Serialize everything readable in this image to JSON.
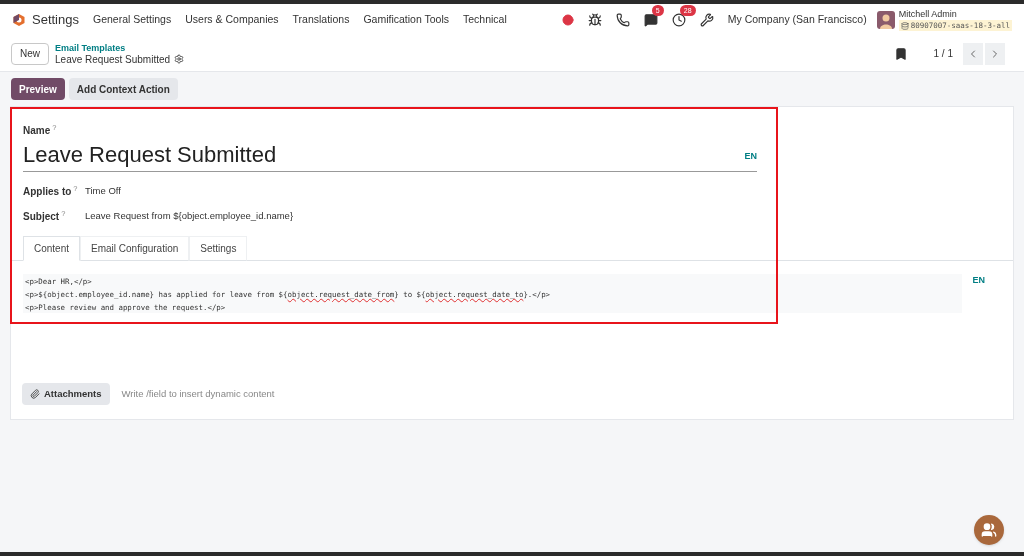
{
  "navbar": {
    "app": "Settings",
    "menu": [
      "General Settings",
      "Users & Companies",
      "Translations",
      "Gamification Tools",
      "Technical"
    ],
    "systray": [
      {
        "kind": "record"
      },
      {
        "kind": "bug"
      },
      {
        "kind": "phone"
      },
      {
        "kind": "chat",
        "badge": "5"
      },
      {
        "kind": "clock",
        "badge": "28"
      },
      {
        "kind": "tools"
      }
    ],
    "company": "My Company (San Francisco)",
    "user": "Mitchell Admin",
    "database": "80907007-saas-18-3-all"
  },
  "breadcrumb": {
    "new_button": "New",
    "parent": "Email Templates",
    "current": "Leave Request Submitted"
  },
  "pager": {
    "value": "1 / 1"
  },
  "actions": [
    {
      "label": "Preview",
      "primary": true
    },
    {
      "label": "Add Context Action",
      "primary": false
    }
  ],
  "form": {
    "name_label": "Name",
    "help_mark": "?",
    "name_value": "Leave Request Submitted",
    "name_lang": "EN",
    "fields": [
      {
        "label": "Applies to",
        "value": "Time Off"
      },
      {
        "label": "Subject",
        "value": "Leave Request from ${object.employee_id.name}"
      }
    ],
    "tabs": [
      {
        "label": "Content",
        "selected": true
      },
      {
        "label": "Email Configuration",
        "selected": false
      },
      {
        "label": "Settings",
        "selected": false
      }
    ],
    "body_lines": [
      [
        {
          "text": "<p>Dear HR,</p>",
          "misspelled": false
        }
      ],
      [
        {
          "text": "<p>${object.employee_id.name} has applied for leave from ${",
          "misspelled": false
        },
        {
          "text": "object.request_date_from",
          "misspelled": true
        },
        {
          "text": "} to ${",
          "misspelled": false
        },
        {
          "text": "object.request_date_to",
          "misspelled": true
        },
        {
          "text": "}.</p>",
          "misspelled": false
        }
      ],
      [
        {
          "text": "<p>Please review and approve the request.</p>",
          "misspelled": false
        }
      ]
    ],
    "body_lang": "EN",
    "attachments_button": "Attachments",
    "hint": "Write /field to insert dynamic content"
  },
  "highlight": {
    "shown": true
  }
}
